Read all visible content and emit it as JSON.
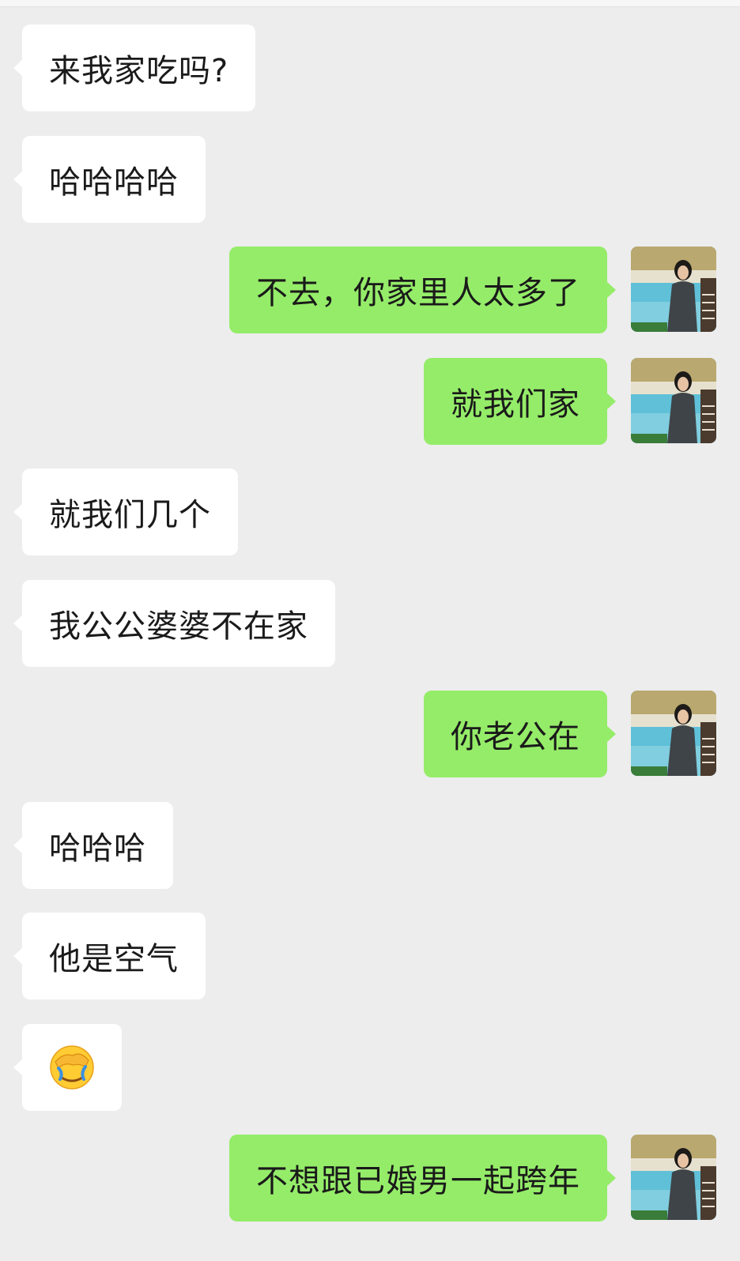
{
  "messages": [
    {
      "side": "in",
      "text": "来我家吃吗?"
    },
    {
      "side": "in",
      "text": "哈哈哈哈"
    },
    {
      "side": "out",
      "text": "不去，你家里人太多了"
    },
    {
      "side": "out",
      "text": "就我们家"
    },
    {
      "side": "in",
      "text": "就我们几个"
    },
    {
      "side": "in",
      "text": "我公公婆婆不在家"
    },
    {
      "side": "out",
      "text": "你老公在"
    },
    {
      "side": "in",
      "text": "哈哈哈"
    },
    {
      "side": "in",
      "text": "他是空气"
    },
    {
      "side": "in",
      "emoji": "face-palm-crying-emoji"
    },
    {
      "side": "out",
      "text": "不想跟已婚男一起跨年"
    }
  ],
  "colors": {
    "background": "#ededed",
    "incoming_bubble": "#ffffff",
    "outgoing_bubble": "#95ec69"
  }
}
